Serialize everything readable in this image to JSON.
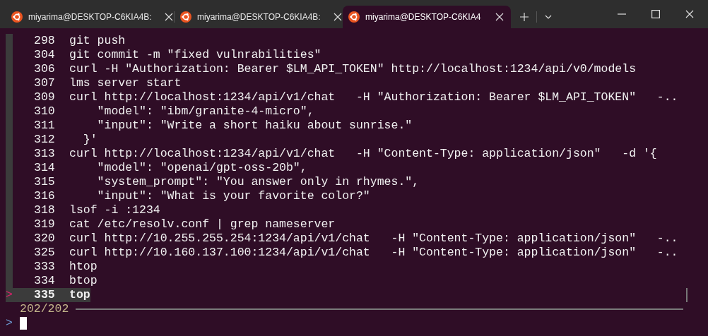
{
  "tabs": [
    {
      "title": "miyarima@DESKTOP-C6KIA4B:",
      "selected": false
    },
    {
      "title": "miyarima@DESKTOP-C6KIA4B:",
      "selected": false
    },
    {
      "title": "miyarima@DESKTOP-C6KIA4",
      "selected": true
    }
  ],
  "history": {
    "pointer": ">",
    "rows": [
      {
        "number": "298",
        "command": "git push",
        "selected": false
      },
      {
        "number": "304",
        "command": "git commit -m \"fixed vulnrabilities\"",
        "selected": false
      },
      {
        "number": "306",
        "command": "curl -H \"Authorization: Bearer $LM_API_TOKEN\" http://localhost:1234/api/v0/models",
        "selected": false
      },
      {
        "number": "307",
        "command": "lms server start",
        "selected": false
      },
      {
        "number": "309",
        "command": "curl http://localhost:1234/api/v1/chat   -H \"Authorization: Bearer $LM_API_TOKEN\"   -..",
        "selected": false
      },
      {
        "number": "310",
        "command": "    \"model\": \"ibm/granite-4-micro\",",
        "selected": false
      },
      {
        "number": "311",
        "command": "    \"input\": \"Write a short haiku about sunrise.\"",
        "selected": false
      },
      {
        "number": "312",
        "command": "  }'",
        "selected": false
      },
      {
        "number": "313",
        "command": "curl http://localhost:1234/api/v1/chat   -H \"Content-Type: application/json\"   -d '{",
        "selected": false
      },
      {
        "number": "314",
        "command": "    \"model\": \"openai/gpt-oss-20b\",",
        "selected": false
      },
      {
        "number": "315",
        "command": "    \"system_prompt\": \"You answer only in rhymes.\",",
        "selected": false
      },
      {
        "number": "316",
        "command": "    \"input\": \"What is your favorite color?\"",
        "selected": false
      },
      {
        "number": "318",
        "command": "lsof -i :1234",
        "selected": false
      },
      {
        "number": "319",
        "command": "cat /etc/resolv.conf | grep nameserver",
        "selected": false
      },
      {
        "number": "320",
        "command": "curl http://10.255.255.254:1234/api/v1/chat   -H \"Content-Type: application/json\"   -..",
        "selected": false
      },
      {
        "number": "325",
        "command": "curl http://10.160.137.100:1234/api/v1/chat   -H \"Content-Type: application/json\"   -..",
        "selected": false
      },
      {
        "number": "333",
        "command": "htop",
        "selected": false
      },
      {
        "number": "334",
        "command": "btop",
        "selected": false
      },
      {
        "number": "335",
        "command": "top",
        "selected": true
      }
    ],
    "count": "202/202",
    "prompt": ">"
  }
}
